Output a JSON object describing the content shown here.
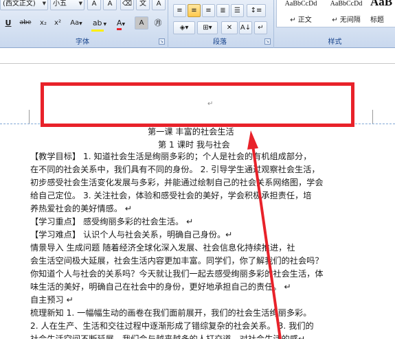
{
  "ribbon": {
    "font_group": {
      "label": "字体",
      "font_name": "(西文正文)",
      "font_size": "小五",
      "buttons": [
        "U",
        "abe",
        "x₂",
        "x²",
        "Aa",
        "A",
        "A",
        "㊊"
      ]
    },
    "paragraph_group": {
      "label": "段落"
    },
    "styles_group": {
      "label": "样式",
      "items": [
        {
          "sample": "AaBbCcDd",
          "name": "↵ 正文"
        },
        {
          "sample": "AaBbCcDd",
          "name": "↵ 无间隔"
        },
        {
          "sample": "AaB",
          "name": "标题"
        }
      ]
    }
  },
  "document": {
    "paragraph_mark": "↵",
    "title": "第一课  丰富的社会生活",
    "subtitle": "第 1 课时  我与社会",
    "lines": [
      "【教学目标】  1. 知道社会生活是绚丽多彩的；个人是社会的有机组成部分，",
      "在不同的社会关系中，我们具有不同的身份。  2. 引导学生通过观察社会生活，",
      "初步感受社会生活变化发展与多彩，并能通过绘制自己的社会关系网络图，学会",
      "给自己定位。  3. 关注社会，体验和感受社会的美好，学会积极承担责任，培",
      "养热爱社会的美好情感。  ↵",
      "【学习重点】  感受绚丽多彩的社会生活。  ↵",
      "【学习难点】  认识个人与社会关系，明确自己身份。↵",
      "    情景导入  生成问题   随着经济全球化深入发展、社会信息化持续推进，社",
      "会生活空间极大延展，社会生活内容更加丰富。同学们，你了解我们的社会吗？",
      "你知道个人与社会的关系吗？今天就让我们一起去感受绚丽多彩的社会生活，体",
      "味生活的美好，明确自己在社会中的身份，更好地承担自己的责任。  ↵",
      "自主预习 ↵",
      "梳理新知   1. 一幅幅生动的画卷在我们面前展开，我们的社会生活绚丽多彩。",
      "2. 人在生产、生活和交往过程中逐渐形成了错综复杂的社会关系。  3. 我们的",
      "社会生活空间不断延展，我们会与越来越多的人打交道，对社会生活的感↵"
    ]
  },
  "colors": {
    "annotation_red": "#e8222a",
    "ribbon_label": "#15428b"
  }
}
